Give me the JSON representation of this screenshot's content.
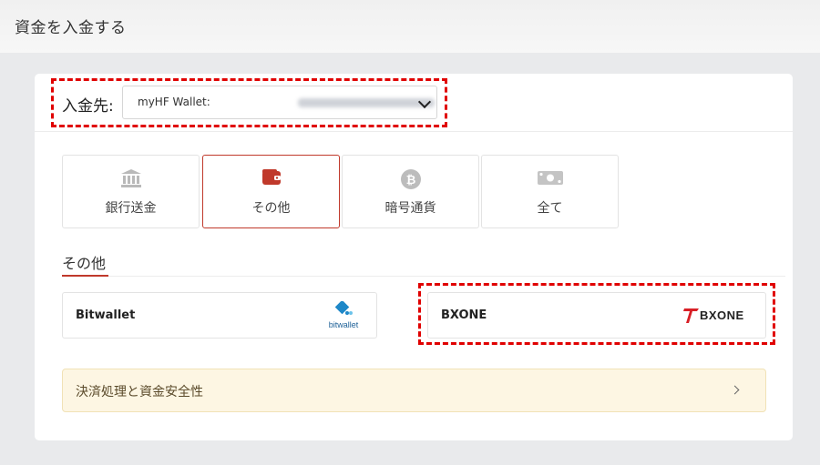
{
  "page": {
    "title": "資金を入金する"
  },
  "destination": {
    "label": "入金先:",
    "selected_value": "myHF Wallet:"
  },
  "categories": [
    {
      "label": "銀行送金",
      "icon": "bank-icon",
      "active": false
    },
    {
      "label": "その他",
      "icon": "wallet-icon",
      "active": true
    },
    {
      "label": "暗号通貨",
      "icon": "bitcoin-icon",
      "active": false
    },
    {
      "label": "全て",
      "icon": "cash-icon",
      "active": false
    }
  ],
  "section": {
    "label": "その他"
  },
  "payment_methods": [
    {
      "name": "Bitwallet",
      "logo_text": "bitwallet"
    },
    {
      "name": "BXONE",
      "logo_text": "BXONE"
    }
  ],
  "notice": {
    "text": "決済処理と資金安全性"
  },
  "colors": {
    "accent": "#c0392b",
    "highlight": "#e00000",
    "notice_bg": "#fdf6e3"
  }
}
